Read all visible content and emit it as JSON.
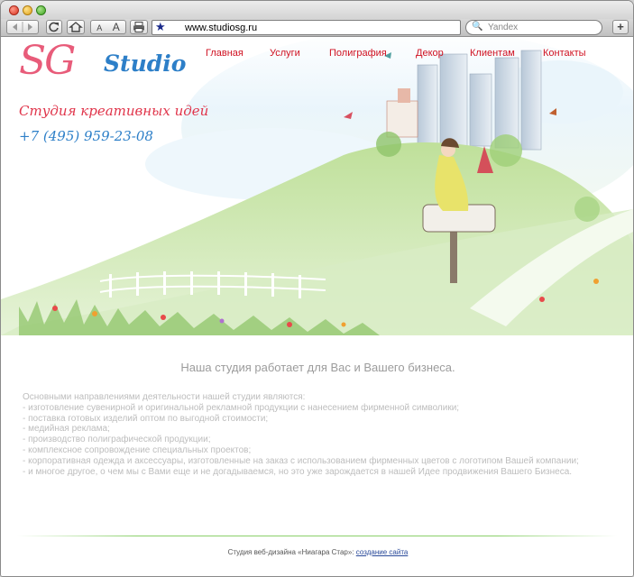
{
  "browser": {
    "url": "www.studiosg.ru",
    "search_placeholder": "Yandex",
    "font_smaller": "A",
    "font_larger": "A",
    "add_label": "+",
    "search_icon": "🔍"
  },
  "site": {
    "logo_sg": "SG",
    "logo_studio": "Studio",
    "tagline": "Студия креативных идей",
    "phone": "+7 (495) 959-23-08",
    "nav": [
      "Главная",
      "Услуги",
      "Полиграфия",
      "Декор",
      "Клиентам",
      "Контакты"
    ],
    "headline": "Наша студия работает для Вас и Вашего бизнеса.",
    "intro": "Основными направлениями деятельности нашей студии являются:",
    "services": [
      "- изготовление сувенирной и оригинальной рекламной продукции с нанесением фирменной символики;",
      "- поставка готовых изделий оптом по выгодной стоимости;",
      "- медийная реклама;",
      "- производство полиграфической продукции;",
      "- комплексное сопровождение специальных проектов;",
      "- корпоративная одежда и аксессуары, изготовленные на заказ с использованием фирменных цветов с логотипом Вашей компании;",
      "- и многое другое, о чем мы с Вами еще и не догадываемся, но это уже зарождается в  нашей Идее продвижения Вашего Бизнеса."
    ],
    "footer_text": "Студия веб-дизайна «Ниагара Стар»: ",
    "footer_link": "создание сайта"
  },
  "colors": {
    "nav": "#d01222",
    "logo_pink": "#e85c7a",
    "logo_blue": "#2d7fc8",
    "grass": "#8fc46a",
    "sky": "#dbeefa"
  }
}
